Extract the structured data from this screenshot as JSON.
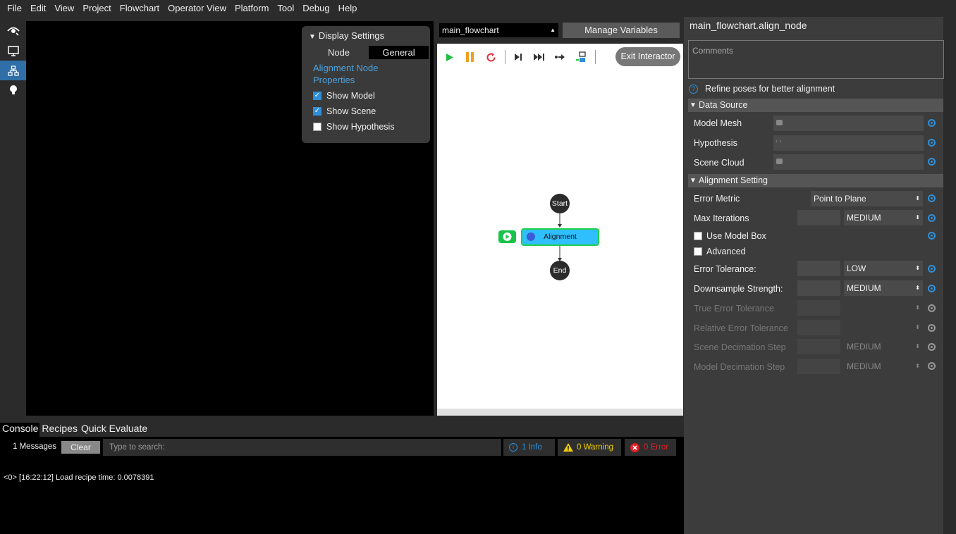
{
  "menu": [
    "File",
    "Edit",
    "View",
    "Project",
    "Flowchart",
    "Operator View",
    "Platform",
    "Tool",
    "Debug",
    "Help"
  ],
  "left_toolbar": [
    {
      "icon": "eye-icon"
    },
    {
      "icon": "monitor-icon"
    },
    {
      "icon": "flowchart-icon",
      "active": true
    },
    {
      "icon": "lightbulb-icon"
    }
  ],
  "display_settings": {
    "header": "Display Settings",
    "tab_node": "Node",
    "tab_general": "General",
    "link": "Alignment Node Properties",
    "show_model": "Show Model",
    "show_scene": "Show Scene",
    "show_hypothesis": "Show Hypothesis",
    "show_model_checked": true,
    "show_scene_checked": true,
    "show_hypothesis_checked": false
  },
  "flowchart": {
    "selected": "main_flowchart",
    "manage_variables": "Manage Variables",
    "exit_interactor": "Exit Interactor",
    "nodes": {
      "start": "Start",
      "alignment": "Alignment",
      "end": "End"
    }
  },
  "properties": {
    "title": "main_flowchart.align_node",
    "comments_placeholder": "Comments",
    "description": "Refine poses for better alignment",
    "data_source": {
      "header": "Data Source",
      "model_mesh": "Model Mesh",
      "hypothesis": "Hypothesis",
      "scene_cloud": "Scene Cloud"
    },
    "alignment_setting": {
      "header": "Alignment Setting",
      "error_metric": "Error Metric",
      "error_metric_value": "Point to Plane",
      "max_iterations": "Max Iterations",
      "max_iterations_value": "MEDIUM",
      "use_model_box": "Use Model Box",
      "advanced": "Advanced",
      "error_tolerance": "Error Tolerance:",
      "error_tolerance_value": "LOW",
      "downsample_strength": "Downsample Strength:",
      "downsample_strength_value": "MEDIUM",
      "true_error_tolerance": "True Error Tolerance",
      "relative_error_tolerance": "Relative Error Tolerance",
      "scene_decimation_step": "Scene Decimation Step",
      "scene_decimation_value": "MEDIUM",
      "model_decimation_step": "Model Decimation Step",
      "model_decimation_value": "MEDIUM"
    }
  },
  "console": {
    "tabs": [
      "Console",
      "Recipes",
      "Quick Evaluate"
    ],
    "message_count": "1 Messages",
    "clear": "Clear",
    "search_placeholder": "Type to search:",
    "info": "1 Info",
    "warning": "0 Warning",
    "error": "0 Error",
    "log_line": "<0> [16:22:12] Load recipe time: 0.0078391"
  },
  "colors": {
    "accent": "#2f8fd8",
    "info": "#2f8fd8",
    "warning": "#f0d000",
    "error": "#e0202a",
    "node_fill": "#2fbfff",
    "node_border": "#1fcf4f"
  }
}
